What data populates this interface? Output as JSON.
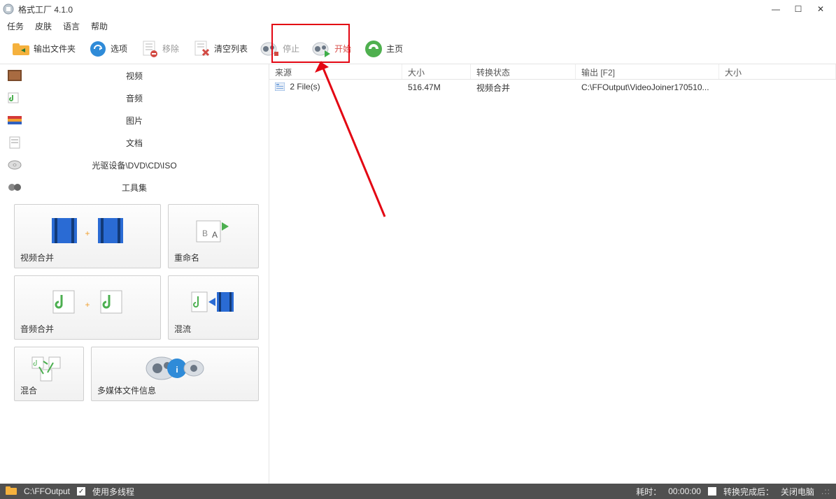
{
  "window": {
    "title": "格式工厂 4.1.0"
  },
  "menu": {
    "task": "任务",
    "skin": "皮肤",
    "lang": "语言",
    "help": "帮助"
  },
  "toolbar": {
    "output_folder": "输出文件夹",
    "options": "选项",
    "remove": "移除",
    "clear": "清空列表",
    "stop": "停止",
    "start": "开始",
    "home": "主页"
  },
  "categories": {
    "video": "视频",
    "audio": "音频",
    "image": "图片",
    "document": "文档",
    "optical": "光驱设备\\DVD\\CD\\ISO",
    "toolbox": "工具集"
  },
  "tiles": {
    "video_join": "视频合并",
    "rename": "重命名",
    "audio_join": "音频合并",
    "mux": "混流",
    "mix": "混合",
    "mediainfo": "多媒体文件信息"
  },
  "list": {
    "headers": {
      "source": "来源",
      "size": "大小",
      "status": "转换状态",
      "output": "输出 [F2]",
      "size2": "大小"
    },
    "rows": [
      {
        "source": "2 File(s)",
        "size": "516.47M",
        "status": "视频合并",
        "output": "C:\\FFOutput\\VideoJoiner170510...",
        "size2": ""
      }
    ]
  },
  "status": {
    "path": "C:\\FFOutput",
    "multithread": "使用多线程",
    "elapsed_label": "耗时：",
    "elapsed": "00:00:00",
    "after_label": "转换完成后：",
    "after_value": "关闭电脑"
  }
}
